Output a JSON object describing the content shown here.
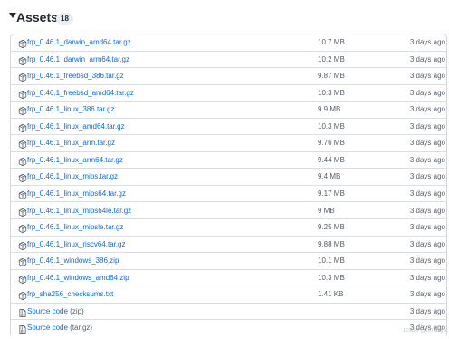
{
  "assets": {
    "title": "Assets",
    "count": "18",
    "rows": [
      {
        "name": "frp_0.46.1_darwin_amd64.tar.gz",
        "size": "10.7 MB",
        "date": "3 days ago",
        "icon": "package-icon"
      },
      {
        "name": "frp_0.46.1_darwin_arm64.tar.gz",
        "size": "10.2 MB",
        "date": "3 days ago",
        "icon": "package-icon"
      },
      {
        "name": "frp_0.46.1_freebsd_386.tar.gz",
        "size": "9.87 MB",
        "date": "3 days ago",
        "icon": "package-icon"
      },
      {
        "name": "frp_0.46.1_freebsd_amd64.tar.gz",
        "size": "10.3 MB",
        "date": "3 days ago",
        "icon": "package-icon"
      },
      {
        "name": "frp_0.46.1_linux_386.tar.gz",
        "size": "9.9 MB",
        "date": "3 days ago",
        "icon": "package-icon"
      },
      {
        "name": "frp_0.46.1_linux_amd64.tar.gz",
        "size": "10.3 MB",
        "date": "3 days ago",
        "icon": "package-icon"
      },
      {
        "name": "frp_0.46.1_linux_arm.tar.gz",
        "size": "9.76 MB",
        "date": "3 days ago",
        "icon": "package-icon"
      },
      {
        "name": "frp_0.46.1_linux_arm64.tar.gz",
        "size": "9.44 MB",
        "date": "3 days ago",
        "icon": "package-icon"
      },
      {
        "name": "frp_0.46.1_linux_mips.tar.gz",
        "size": "9.4 MB",
        "date": "3 days ago",
        "icon": "package-icon"
      },
      {
        "name": "frp_0.46.1_linux_mips64.tar.gz",
        "size": "9.17 MB",
        "date": "3 days ago",
        "icon": "package-icon"
      },
      {
        "name": "frp_0.46.1_linux_mips64le.tar.gz",
        "size": "9 MB",
        "date": "3 days ago",
        "icon": "package-icon"
      },
      {
        "name": "frp_0.46.1_linux_mipsle.tar.gz",
        "size": "9.25 MB",
        "date": "3 days ago",
        "icon": "package-icon"
      },
      {
        "name": "frp_0.46.1_linux_riscv64.tar.gz",
        "size": "9.88 MB",
        "date": "3 days ago",
        "icon": "package-icon"
      },
      {
        "name": "frp_0.46.1_windows_386.zip",
        "size": "10.1 MB",
        "date": "3 days ago",
        "icon": "package-icon"
      },
      {
        "name": "frp_0.46.1_windows_amd64.zip",
        "size": "10.3 MB",
        "date": "3 days ago",
        "icon": "package-icon"
      },
      {
        "name": "frp_sha256_checksums.txt",
        "size": "1.41 KB",
        "date": "3 days ago",
        "icon": "package-icon"
      },
      {
        "name": "Source code",
        "sub": "(zip)",
        "size": "",
        "date": "3 days ago",
        "icon": "file-zip-icon"
      },
      {
        "name": "Source code",
        "sub": "(tar.gz)",
        "size": "",
        "date": "3 days ago",
        "icon": "file-zip-icon"
      }
    ]
  },
  "watermark": "CSDN @Gmanyo"
}
